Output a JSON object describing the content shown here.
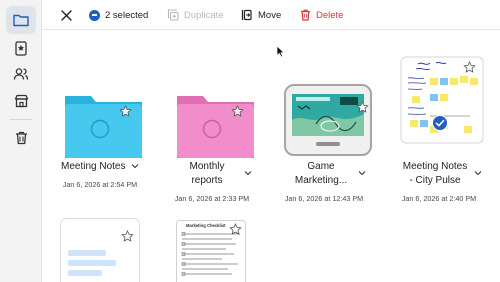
{
  "sidebar": {
    "items": [
      {
        "icon": "folder-icon",
        "active": true
      },
      {
        "icon": "bookmark-icon",
        "active": false
      },
      {
        "icon": "people-icon",
        "active": false
      },
      {
        "icon": "store-icon",
        "active": false
      },
      {
        "icon": "trash-icon",
        "active": false
      }
    ]
  },
  "toolbar": {
    "selected_label": "2 selected",
    "duplicate_label": "Duplicate",
    "move_label": "Move",
    "delete_label": "Delete"
  },
  "colors": {
    "accent": "#1f5fbf",
    "danger": "#d23b3b",
    "folder_blue": "#3cc1ea",
    "folder_pink": "#ea86c4"
  },
  "items": [
    {
      "name": "Meeting Notes",
      "date": "Jan 6, 2026 at 2:54 PM",
      "type": "folder",
      "selected": false
    },
    {
      "name_line1": "Monthly",
      "name_line2": "reports",
      "date": "Jan 6, 2026 at 2:33 PM",
      "type": "folder",
      "selected": false
    },
    {
      "name_line1": "Game",
      "name_line2": "Marketing...",
      "date": "Jan 6, 2026 at 12:43 PM",
      "type": "board",
      "selected": false
    },
    {
      "name_line1": "Meeting Notes",
      "name_line2": "- City Pulse",
      "date": "Jan 6, 2026 at 2:40 PM",
      "type": "board",
      "selected": true
    },
    {
      "type": "document",
      "selected": false
    },
    {
      "title": "Marketing Checklist",
      "type": "document",
      "selected": false
    }
  ]
}
